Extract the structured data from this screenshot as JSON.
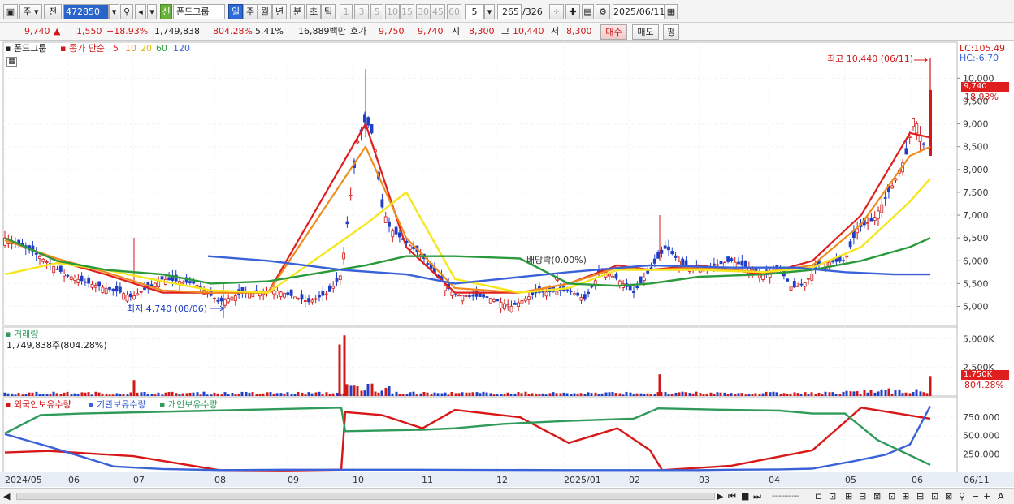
{
  "toolbar": {
    "market_tab": "주",
    "prev_tab": "전",
    "code": "472850",
    "badge_new": "신",
    "stock_name": "폰드그룹",
    "periods": [
      "일",
      "주",
      "월",
      "년",
      "분",
      "초",
      "틱"
    ],
    "ticks": [
      "1",
      "3",
      "5",
      "10",
      "15",
      "30",
      "45",
      "60"
    ],
    "unit_value": "5",
    "count_current": "265",
    "count_total": "/326",
    "date": "2025/06/11"
  },
  "quote": {
    "price": "9,740",
    "price_arrow": "▲",
    "change": "1,550",
    "change_pct": "+18.93%",
    "volume": "1,749,838",
    "vol_ratio": "804.28%",
    "turnover": "5.41%",
    "amount": "16,889백만",
    "bid_label": "호가",
    "bid1": "9,750",
    "bid2": "9,740",
    "open_label": "시",
    "open": "8,300",
    "high_label": "고",
    "high": "10,440",
    "low_label": "저",
    "low": "8,300",
    "buy_btn": "매수",
    "sell_btn": "매도",
    "eval_btn": "평"
  },
  "price_panel": {
    "stock_name": "폰드그룹",
    "legend_title": "종가 단순",
    "ma_periods": [
      "5",
      "10",
      "20",
      "60",
      "120"
    ],
    "lc_label": "LC:105.49",
    "hc_label": "HC:-6.70",
    "high_annot": "최고 10,440 (06/11)",
    "low_annot": "최저 4,740 (08/06)",
    "dividend_annot": "배당락(0.00%)",
    "price_tag": "9,740",
    "pct_tag": "18.93%"
  },
  "volume_panel": {
    "title": "거래량",
    "value_text": "1,749,838주(804.28%)",
    "tag_value": "1,750K",
    "tag_pct": "804.28%"
  },
  "holding_panel": {
    "legend": [
      "외국인보유수량",
      "기관보유수량",
      "개인보유수량"
    ]
  },
  "x_axis_labels": [
    "2024/05",
    "06",
    "07",
    "08",
    "09",
    "10",
    "11",
    "12",
    "2025/01",
    "02",
    "03",
    "04",
    "05",
    "06",
    "06/11"
  ],
  "colors": {
    "up": "#d01818",
    "down": "#1f3fc8",
    "ma5": "#e01e1e",
    "ma10": "#f08c1e",
    "ma20": "#f5e61e",
    "ma60": "#2b9a3c",
    "ma120": "#3a62d8",
    "foreign": "#d81818",
    "institution": "#3a62d8",
    "individual": "#2f9a5a"
  },
  "chart_data": [
    {
      "type": "line",
      "title": "",
      "x": [
        "2024/05",
        "06",
        "07",
        "08",
        "09",
        "10",
        "11",
        "12",
        "2025/01",
        "02",
        "03",
        "04",
        "05",
        "06",
        "06/11"
      ],
      "y_ticks": [
        5000,
        5500,
        6000,
        6500,
        7000,
        7500,
        8000,
        8500,
        9000,
        9500,
        10000
      ],
      "ylim": [
        4600,
        10700
      ],
      "series": [
        {
          "name": "5",
          "values": [
            6500,
            6000,
            5700,
            5300,
            5300,
            5300,
            9000,
            6300,
            5300,
            5300,
            5500,
            5900,
            5800,
            5900,
            5700,
            6000,
            7000,
            8800,
            8700
          ]
        },
        {
          "name": "10",
          "values": [
            6450,
            6050,
            5750,
            5350,
            5300,
            5300,
            8500,
            6500,
            5400,
            5300,
            5500,
            5850,
            5800,
            5850,
            5750,
            5900,
            6800,
            8300,
            8500
          ]
        },
        {
          "name": "20",
          "values": [
            5700,
            5950,
            5800,
            5550,
            5350,
            5300,
            6800,
            7500,
            5600,
            5300,
            5400,
            5800,
            5800,
            5800,
            5750,
            5850,
            6300,
            7300,
            7800
          ]
        },
        {
          "name": "60",
          "values": [
            6500,
            6000,
            5800,
            5700,
            5500,
            5550,
            5900,
            6100,
            6100,
            6050,
            5500,
            5450,
            5500,
            5650,
            5700,
            5800,
            6000,
            6300,
            6500
          ]
        },
        {
          "name": "120",
          "values": [
            6100,
            6000,
            5800,
            5700,
            5500,
            5750,
            5900,
            5850,
            5850,
            5750,
            5700,
            5700
          ]
        }
      ]
    },
    {
      "type": "bar",
      "title": "거래량",
      "y_ticks": [
        2500,
        5000
      ],
      "ylim": [
        0,
        5600
      ],
      "unit": "K",
      "spikes": [
        {
          "x": "07",
          "value": 1400
        },
        {
          "x": "10",
          "value": 4500
        },
        {
          "x": "10",
          "value": 5300
        },
        {
          "x": "02",
          "value": 1900
        },
        {
          "x": "06/11",
          "value": 1750
        }
      ]
    },
    {
      "type": "line",
      "title": "",
      "y_ticks": [
        250000,
        500000,
        750000
      ],
      "ylim": [
        0,
        950000
      ],
      "series": [
        {
          "name": "외국인보유수량",
          "values": [
            270000,
            290000,
            250000,
            220000,
            30000,
            25000,
            35000,
            820000,
            780000,
            600000,
            850000,
            750000,
            400000,
            600000,
            300000,
            30000,
            90000,
            300000,
            880000,
            730000
          ]
        },
        {
          "name": "기관보유수량",
          "values": [
            520000,
            350000,
            80000,
            45000,
            30000,
            35000,
            35000,
            30000,
            30000,
            30000,
            35000,
            40000,
            50000,
            150000,
            240000,
            380000,
            900000
          ]
        },
        {
          "name": "개인보유수량",
          "values": [
            530000,
            780000,
            800000,
            850000,
            880000,
            560000,
            580000,
            600000,
            660000,
            700000,
            730000,
            870000,
            850000,
            840000,
            800000,
            800000,
            440000,
            100000
          ]
        }
      ]
    }
  ]
}
